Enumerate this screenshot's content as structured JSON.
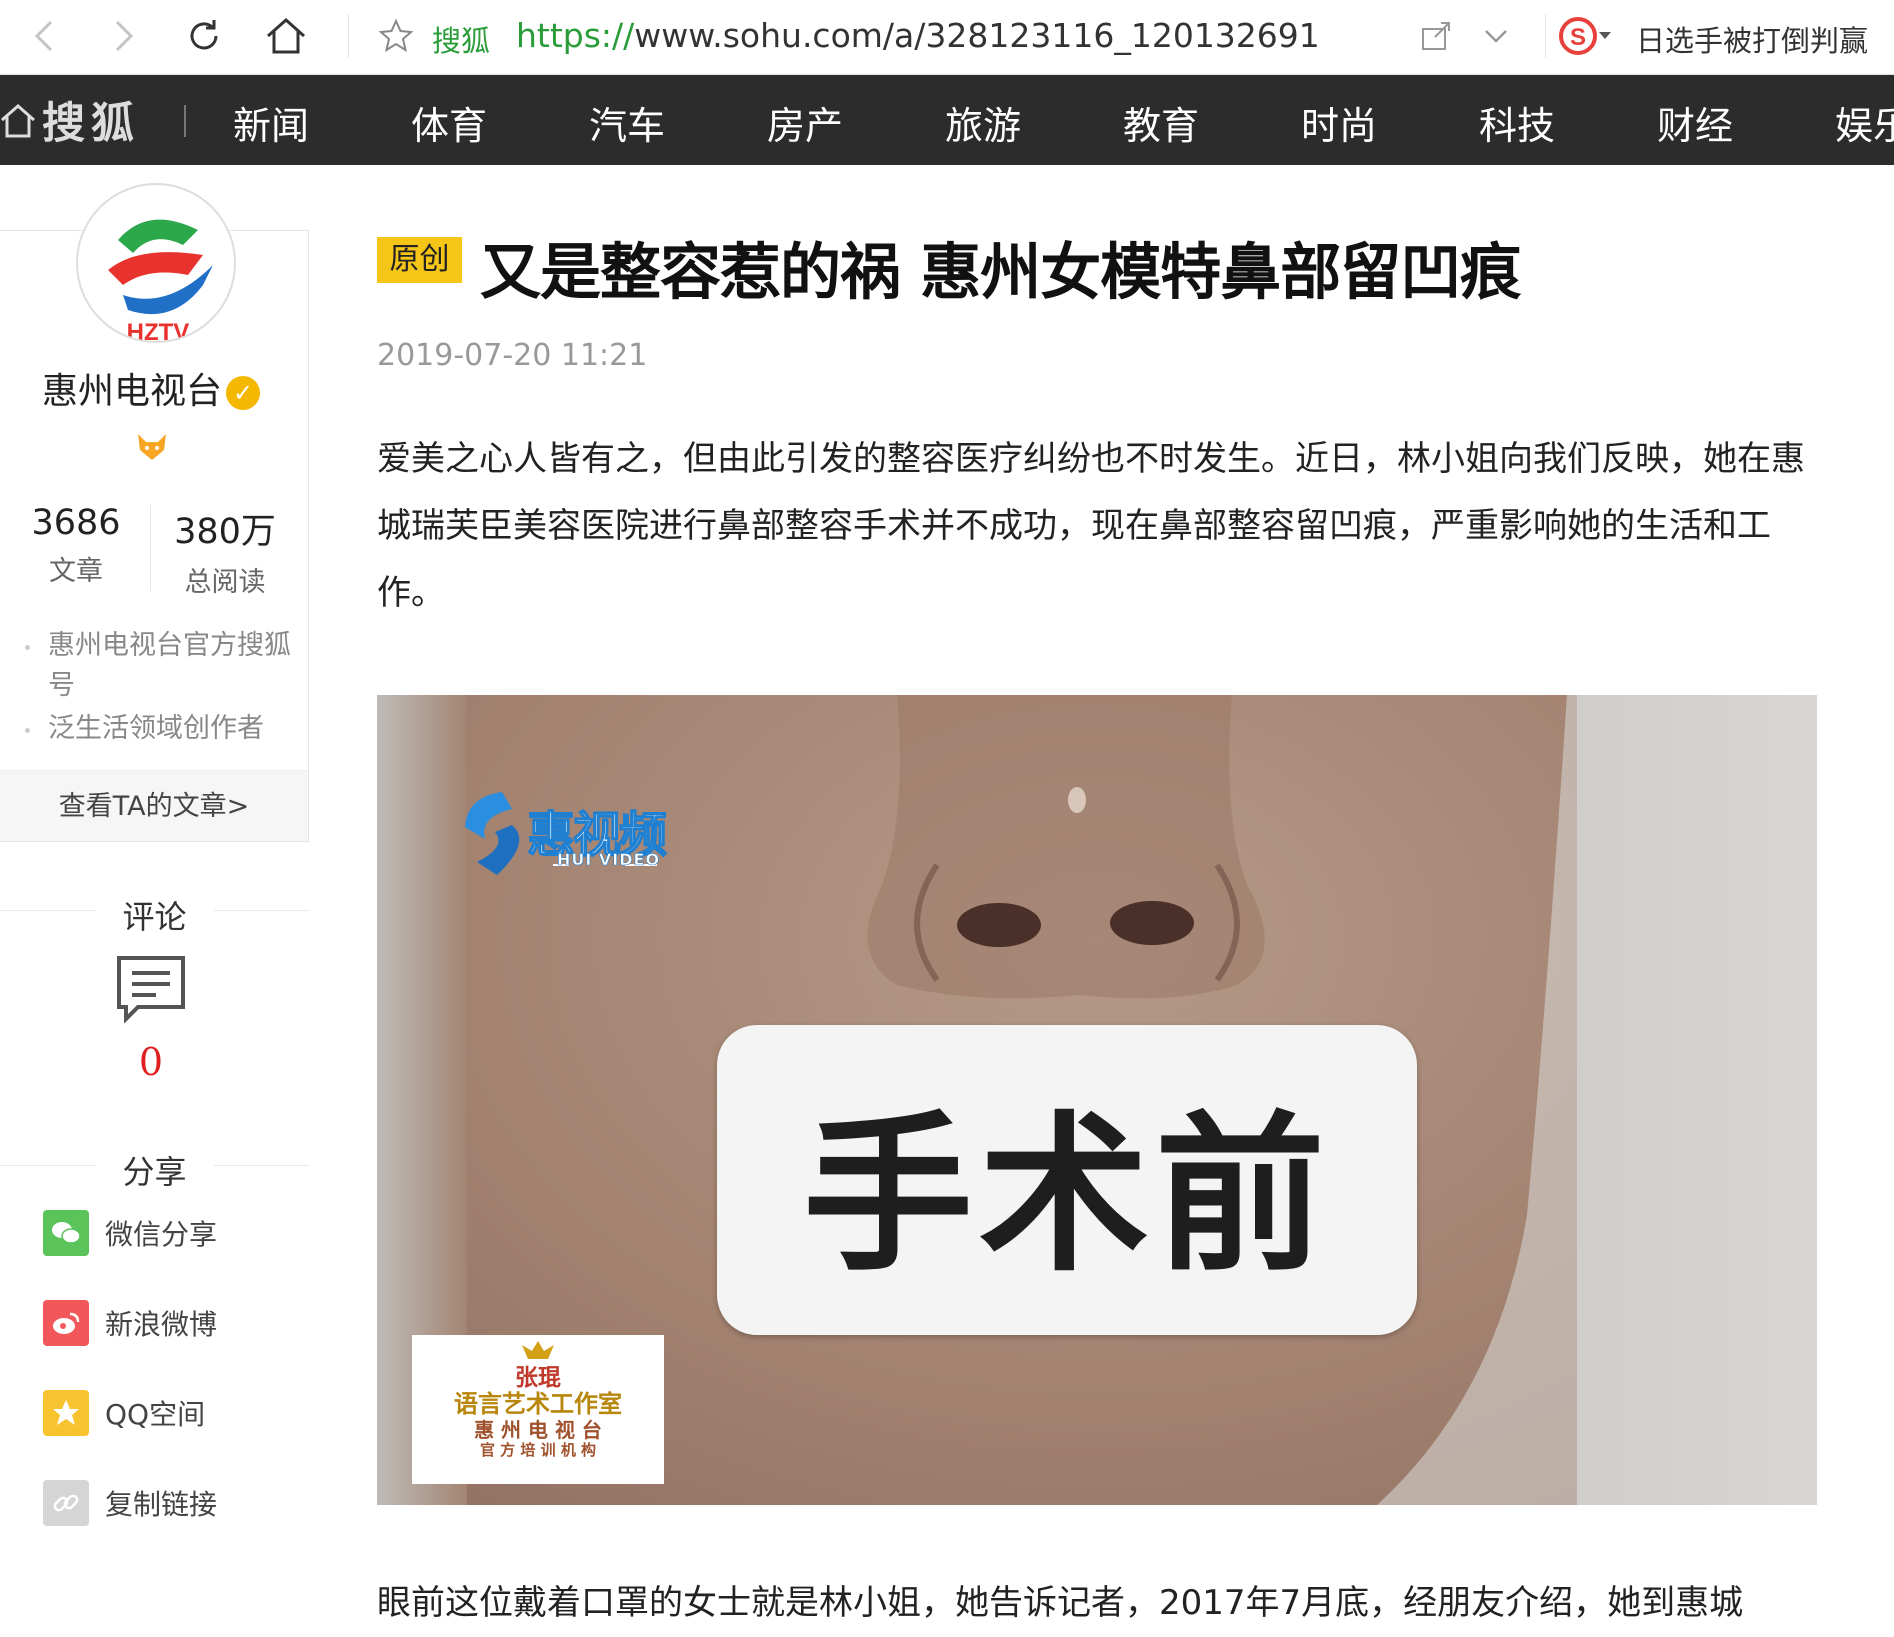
{
  "browser": {
    "site_name": "搜狐",
    "url_protocol": "https://",
    "url_rest": "www.sohu.com/a/328123116_120132691",
    "search_hint": "日选手被打倒判赢"
  },
  "site_nav": {
    "logo_text": "搜狐",
    "items": [
      "新闻",
      "体育",
      "汽车",
      "房产",
      "旅游",
      "教育",
      "时尚",
      "科技",
      "财经",
      "娱乐"
    ]
  },
  "author": {
    "name": "惠州电视台",
    "article_count": "3686",
    "article_label": "文章",
    "read_count": "380万",
    "read_label": "总阅读",
    "tags": [
      "惠州电视台官方搜狐号",
      "泛生活领域创作者"
    ],
    "view_articles": "查看TA的文章>"
  },
  "comment": {
    "title": "评论",
    "count": "0"
  },
  "share": {
    "title": "分享",
    "items": [
      {
        "label": "微信分享",
        "icon": "wechat-icon",
        "color": "#5ac35a"
      },
      {
        "label": "新浪微博",
        "icon": "weibo-icon",
        "color": "#f2585a"
      },
      {
        "label": "QQ空间",
        "icon": "qzone-icon",
        "color": "#f7c32e"
      },
      {
        "label": "复制链接",
        "icon": "link-icon",
        "color": "#d5d5d5"
      }
    ]
  },
  "article": {
    "badge": "原创",
    "title": "又是整容惹的祸 惠州女模特鼻部留凹痕",
    "date": "2019-07-20 11:21",
    "paragraph1": "爱美之心人皆有之，但由此引发的整容医疗纠纷也不时发生。近日，林小姐向我们反映，她在惠城瑞芙臣美容医院进行鼻部整容手术并不成功，现在鼻部整容留凹痕，严重影响她的生活和工作。",
    "paragraph2": "眼前这位戴着口罩的女士就是林小姐，她告诉记者，2017年7月底，经朋友介绍，她到惠城"
  },
  "photo": {
    "sign_text": "手术前",
    "watermark_name": "惠视频",
    "watermark_sub": "HUI VIDEO",
    "studio_lines": [
      "张琨",
      "语言艺术工作室",
      "惠 州 电 视 台",
      "官 方 培 训 机 构"
    ]
  }
}
